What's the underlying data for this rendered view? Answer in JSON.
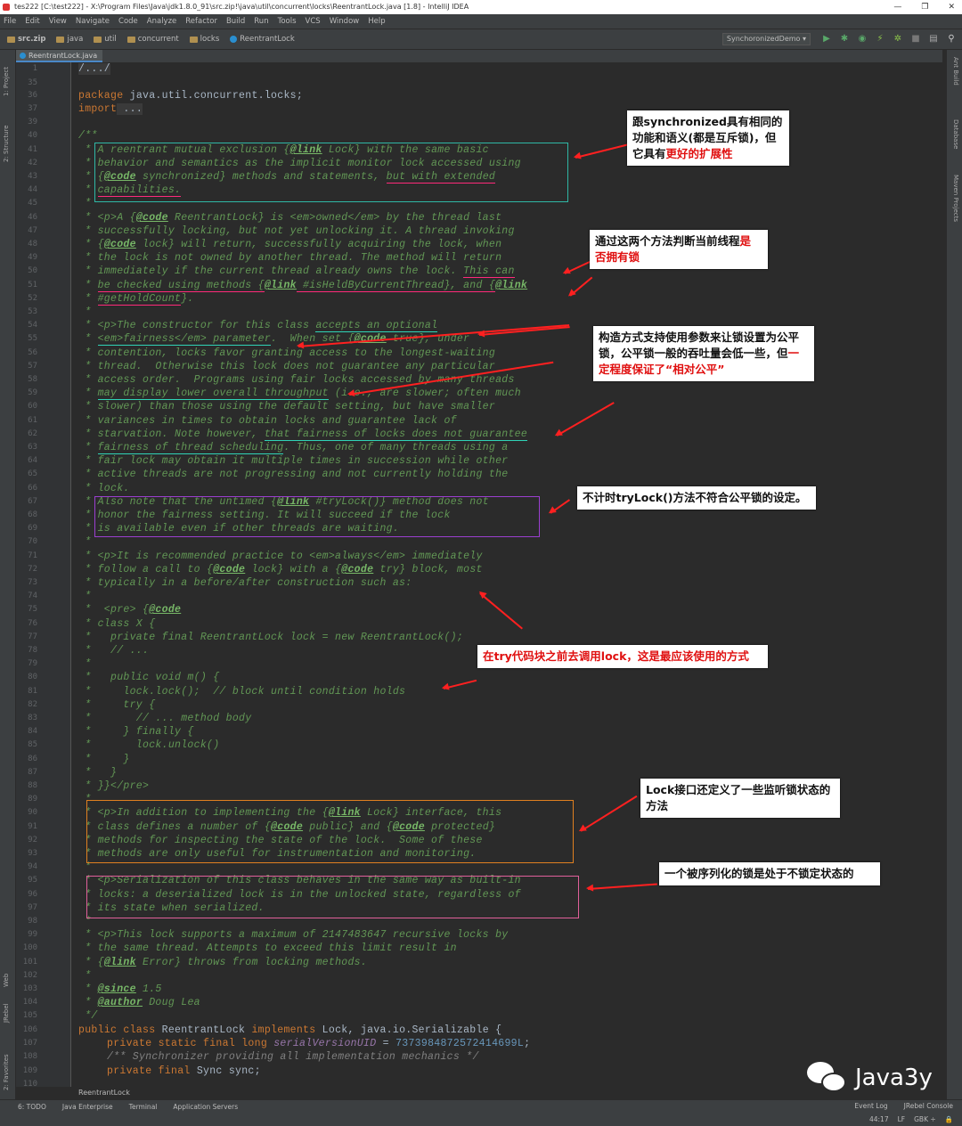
{
  "window": {
    "title": "tes222 [C:\\test222] - X:\\Program Files\\Java\\jdk1.8.0_91\\src.zip!\\java\\util\\concurrent\\locks\\ReentrantLock.java [1.8] - IntelliJ IDEA",
    "controls": [
      "—",
      "❐",
      "✕"
    ]
  },
  "menu": [
    "File",
    "Edit",
    "View",
    "Navigate",
    "Code",
    "Analyze",
    "Refactor",
    "Build",
    "Run",
    "Tools",
    "VCS",
    "Window",
    "Help"
  ],
  "breadcrumbs": [
    "src.zip",
    "java",
    "util",
    "concurrent",
    "locks",
    "ReentrantLock"
  ],
  "run_config": "SynchoronizedDemo ▾",
  "editor_tab": "ReentrantLock.java",
  "left_tools": [
    "1: Project",
    "2: Structure",
    "Web",
    "JRebel",
    "2: Favorites"
  ],
  "right_tools": [
    "Ant Build",
    "Database",
    "Maven Projects"
  ],
  "line_numbers": [
    "1",
    "35",
    "36",
    "37",
    "39",
    "40",
    "41",
    "42",
    "43",
    "44",
    "45",
    "46",
    "47",
    "48",
    "49",
    "50",
    "51",
    "52",
    "53",
    "54",
    "55",
    "56",
    "57",
    "58",
    "59",
    "60",
    "61",
    "62",
    "63",
    "64",
    "65",
    "66",
    "67",
    "68",
    "69",
    "70",
    "71",
    "72",
    "73",
    "74",
    "75",
    "76",
    "77",
    "78",
    "79",
    "80",
    "81",
    "82",
    "83",
    "84",
    "85",
    "86",
    "87",
    "88",
    "89",
    "90",
    "91",
    "92",
    "93",
    "94",
    "95",
    "96",
    "97",
    "98",
    "99",
    "100",
    "101",
    "102",
    "103",
    "104",
    "105",
    "106",
    "107",
    "108",
    "109",
    "110"
  ],
  "code": {
    "l1": "/.../",
    "l36_kw": "package",
    "l36_rest": " java.util.concurrent.locks;",
    "l37_kw": "import",
    "l37_rest": " ...",
    "l40": "/**",
    "l41a": " * A reentrant mutual exclusion {",
    "l41tag": "@link",
    "l41b": " Lock} with the same basic",
    "l42": " * behavior and semantics as the implicit monitor lock accessed using",
    "l43a": " * {",
    "l43tag": "@code",
    "l43b": " synchronized} methods and statements, ",
    "l43c": "but with extended",
    "l44a": " * ",
    "l44b": "capabilities.",
    "l45": " *",
    "l46a": " * <p>A {",
    "l46tag": "@code",
    "l46b": " ReentrantLock} is <em>owned</em> by the thread last",
    "l47": " * successfully locking, but not yet unlocking it. A thread invoking",
    "l48a": " * {",
    "l48tag": "@code",
    "l48b": " lock} will return, successfully acquiring the lock, when",
    "l49": " * the lock is not owned by another thread. The method will return",
    "l50a": " * immediately if the current thread already owns the lock. ",
    "l50b": "This can",
    "l51a": " * ",
    "l51b": "be checked using methods {",
    "l51tag": "@link",
    "l51c": " #isHeldByCurrentThread}, and {",
    "l51tag2": "@link",
    "l52a": " * ",
    "l52b": "#getHoldCount",
    "l52c": "}.",
    "l53": " *",
    "l54a": " * <p>The constructor for this class ",
    "l54b": "accepts an optional",
    "l55a": " * ",
    "l55b": "<em>fairness</em> parameter",
    "l55c": ".  When set {",
    "l55tag": "@code",
    "l55d": " true}, under",
    "l56": " * contention, locks favor granting access to the longest-waiting",
    "l57": " * thread.  Otherwise this lock does not guarantee any particular",
    "l58": " * access order.  Programs using fair locks accessed by many threads",
    "l59a": " * ",
    "l59b": "may display lower overall throughput",
    "l59c": " (i.e., are slower; often much",
    "l60": " * slower) than those using the default setting, but have smaller",
    "l61": " * variances in times to obtain locks and guarantee lack of",
    "l62a": " * starvation. Note however, ",
    "l62b": "that fairness of locks does not guarantee",
    "l63a": " * ",
    "l63b": "fairness of thread scheduling",
    "l63c": ". Thus, one of many threads using a",
    "l64": " * fair lock may obtain it multiple times in succession while other",
    "l65": " * active threads are not progressing and not currently holding the",
    "l66": " * lock.",
    "l67a": " * Also note that the untimed {",
    "l67tag": "@link",
    "l67b": " #tryLock()} method does not",
    "l68": " * honor the fairness setting. It will succeed if the lock",
    "l69": " * is available even if other threads are waiting.",
    "l70": " *",
    "l71": " * <p>It is recommended practice to <em>always</em> immediately",
    "l72a": " * follow a call to {",
    "l72tag": "@code",
    "l72b": " lock} with a {",
    "l72tag2": "@code",
    "l72c": " try} block, most",
    "l73": " * typically in a before/after construction such as:",
    "l74": " *",
    "l75a": " *  <pre> {",
    "l75tag": "@code",
    "l76": " * class X {",
    "l77": " *   private final ReentrantLock lock = new ReentrantLock();",
    "l78": " *   // ...",
    "l79": " *",
    "l80": " *   public void m() {",
    "l81": " *     lock.lock();  // block until condition holds",
    "l82": " *     try {",
    "l83": " *       // ... method body",
    "l84": " *     } finally {",
    "l85": " *       lock.unlock()",
    "l86": " *     }",
    "l87": " *   }",
    "l88": " * }}</pre>",
    "l89": " *",
    "l90a": " * <p>In addition to implementing the {",
    "l90tag": "@link",
    "l90b": " Lock} interface, this",
    "l91a": " * class defines a number of {",
    "l91tag": "@code",
    "l91b": " public} and {",
    "l91tag2": "@code",
    "l91c": " protected}",
    "l92": " * methods for inspecting the state of the lock.  Some of these",
    "l93": " * methods are only useful for instrumentation and monitoring.",
    "l94": " *",
    "l95": " * <p>Serialization of this class behaves in the same way as built-in",
    "l96": " * locks: a deserialized lock is in the unlocked state, regardless of",
    "l97": " * its state when serialized.",
    "l98": " *",
    "l99": " * <p>This lock supports a maximum of 2147483647 recursive locks by",
    "l100": " * the same thread. Attempts to exceed this limit result in",
    "l101a": " * {",
    "l101tag": "@link",
    "l101b": " Error} throws from locking methods.",
    "l102": " *",
    "l103a": " * ",
    "l103tag": "@since",
    "l103b": " 1.5",
    "l104a": " * ",
    "l104tag": "@author",
    "l104b": " Doug Lea",
    "l105": " */",
    "l106kw": "public class",
    "l106a": " ReentrantLock ",
    "l106kw2": "implements",
    "l106b": " Lock, java.io.Serializable {",
    "l107kw": "private static final long",
    "l107f": " serialVersionUID",
    "l107eq": " = ",
    "l107num": "7373984872572414699L",
    "l107end": ";",
    "l108": "/** Synchronizer providing all implementation mechanics */",
    "l109kw": "private final",
    "l109b": " Sync sync;"
  },
  "annotations": {
    "n1a": "跟synchronized具有相同的",
    "n1b": "功能和语义(都是互斥锁)，但",
    "n1c": "它具有",
    "n1d": "更好的扩展性",
    "n2a": "通过这两个方法判断当前线程",
    "n2b": "是",
    "n2c": "否拥有锁",
    "n3a": "构造方式支持使用参数来让锁设置为公平",
    "n3b": "锁，公平锁一般的吞吐量会低一些，但",
    "n3c": "一",
    "n3d": "定程度保证了“相对公平”",
    "n4": "不计时tryLock()方法不符合公平锁的设定。",
    "n5": "在try代码块之前去调用lock，这是最应该使用的方式",
    "n6a": "Lock接口还定义了一些监听锁状态的",
    "n6b": "方法",
    "n7": "一个被序列化的锁是处于不锁定状态的"
  },
  "editor_breadcrumb": "ReentrantLock",
  "bottom_tools": [
    "6: TODO",
    "Java Enterprise",
    "Terminal",
    "Application Servers"
  ],
  "bottom_right_tools": [
    "Event Log",
    "JRebel Console"
  ],
  "status": {
    "position": "44:17",
    "line_sep": "LF",
    "encoding": "GBK ÷"
  },
  "watermark": "Java3y",
  "colors": {
    "bg": "#2b2b2b",
    "comment": "#629755",
    "keyword": "#cc7832",
    "teal_box": "#2fb8a6",
    "purple_box": "#9b3fd0",
    "orange_box": "#e08020",
    "pink_box": "#e0609a",
    "arrow": "#ff2020"
  }
}
